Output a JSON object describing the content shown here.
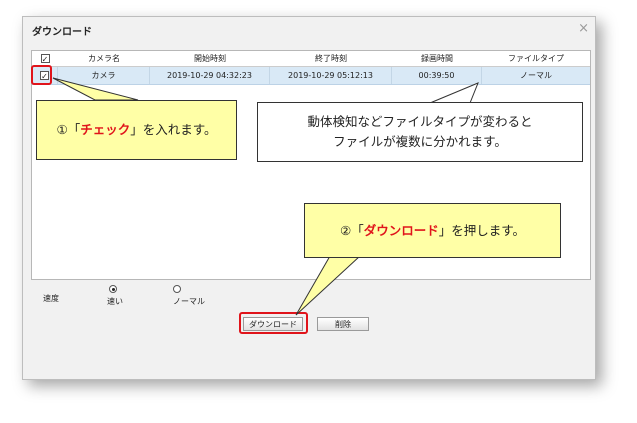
{
  "dialog": {
    "title": "ダウンロード",
    "close": "×"
  },
  "table": {
    "headers": [
      "カメラ名",
      "開始時刻",
      "終了時刻",
      "録画時間",
      "ファイルタイプ"
    ],
    "rows": [
      {
        "checked": true,
        "camera": "カメラ",
        "start": "2019-10-29 04:32:23",
        "end": "2019-10-29 05:12:13",
        "duration": "00:39:50",
        "type": "ノーマル"
      }
    ]
  },
  "speed": {
    "label": "速度",
    "options": [
      {
        "label": "速い",
        "selected": true
      },
      {
        "label": "ノーマル",
        "selected": false
      }
    ]
  },
  "buttons": {
    "download": "ダウンロード",
    "delete": "削除"
  },
  "callouts": {
    "check": {
      "pre": "①「",
      "emph": "チェック",
      "post": "」を入れます。"
    },
    "filetype": {
      "line1": "動体検知などファイルタイプが変わると",
      "line2": "ファイルが複数に分かれます。"
    },
    "download": {
      "pre": "②「",
      "emph": "ダウンロード",
      "post": "」を押します。"
    }
  },
  "colors": {
    "accent_red": "#e0141b",
    "callout_yellow": "#ffffa6",
    "row_selected": "#d9e9f6"
  }
}
